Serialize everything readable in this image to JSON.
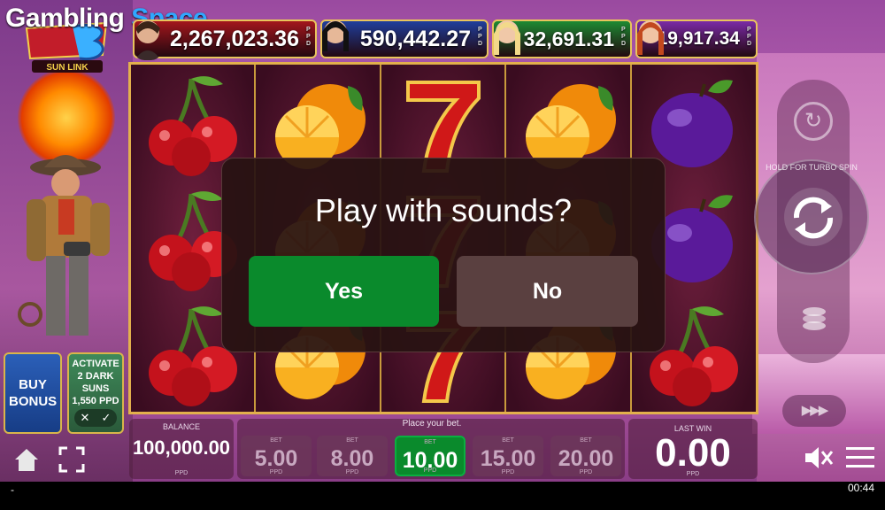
{
  "watermark": {
    "part1": "Gambling",
    "part2": "Space"
  },
  "game_logo": {
    "line": "SUN LINK"
  },
  "jackpots": [
    {
      "value": "2,267,023.36",
      "unit": "PPD",
      "color": "#a3161c"
    },
    {
      "value": "590,442.27",
      "unit": "PPD",
      "color": "#1f3e9c"
    },
    {
      "value": "32,691.31",
      "unit": "PPD",
      "color": "#1d8a32"
    },
    {
      "value": "19,917.34",
      "unit": "PPD",
      "color": "#7a2aa6"
    }
  ],
  "left_buttons": {
    "buy_bonus": "BUY BONUS",
    "activate": "ACTIVATE 2 DARK SUNS",
    "activate_cost": "1,550 PPD",
    "toggle_off": "✕",
    "toggle_on": "✓"
  },
  "reels": [
    [
      "cherry",
      "cherry",
      "cherry"
    ],
    [
      "orange",
      "orange",
      "orange"
    ],
    [
      "seven",
      "seven",
      "seven"
    ],
    [
      "orange",
      "orange",
      "orange"
    ],
    [
      "plum",
      "plum",
      "cherry"
    ]
  ],
  "dialog": {
    "title": "Play with sounds?",
    "yes": "Yes",
    "no": "No"
  },
  "right_controls": {
    "turbo_hint": "HOLD FOR TURBO SPIN",
    "fast": "▶▶▶"
  },
  "bottom": {
    "balance_label": "BALANCE",
    "balance_value": "100,000.00",
    "currency": "PPD",
    "place_bet": "Place your bet.",
    "bet_label": "BET",
    "bets": [
      "5.00",
      "8.00",
      "10.00",
      "15.00",
      "20.00"
    ],
    "active_bet_index": 2,
    "last_win_label": "LAST WIN",
    "last_win_value": "0.00"
  },
  "status_bar": {
    "left": "-",
    "time": "00:44"
  },
  "colors": {
    "yes_button": "#0a8a2c",
    "no_button": "#5a4040",
    "reel_border": "#e2b04c"
  }
}
